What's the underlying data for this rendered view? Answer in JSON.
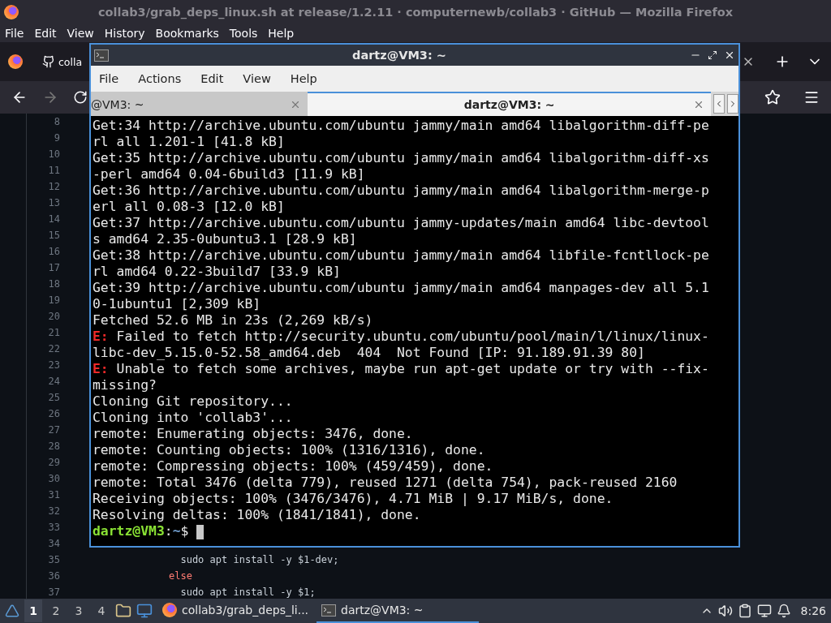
{
  "browser": {
    "title": "collab3/grab_deps_linux.sh at release/1.2.11 · computernewb/collab3 · GitHub — Mozilla Firefox",
    "menu": [
      "File",
      "Edit",
      "View",
      "History",
      "Bookmarks",
      "Tools",
      "Help"
    ],
    "tab": {
      "label": "colla"
    },
    "code": {
      "rows": [
        {
          "number": "8"
        },
        {
          "number": "9"
        },
        {
          "number": "10"
        },
        {
          "number": "11"
        },
        {
          "number": "12"
        },
        {
          "number": "13"
        },
        {
          "number": "14"
        },
        {
          "number": "15"
        },
        {
          "number": "16"
        },
        {
          "number": "17"
        },
        {
          "number": "18"
        },
        {
          "number": "19"
        },
        {
          "number": "20"
        },
        {
          "number": "21"
        },
        {
          "number": "22"
        },
        {
          "number": "23"
        },
        {
          "number": "24"
        },
        {
          "number": "25"
        },
        {
          "number": "26"
        },
        {
          "number": "27"
        },
        {
          "number": "28"
        },
        {
          "number": "29"
        },
        {
          "number": "30"
        },
        {
          "number": "31"
        },
        {
          "number": "32"
        },
        {
          "number": "33"
        },
        {
          "number": "34"
        },
        {
          "number": "35",
          "kind": "plain",
          "text": "  sudo apt install -y $1-dev;"
        },
        {
          "number": "36",
          "kind": "keyword",
          "text": "else"
        },
        {
          "number": "37",
          "kind": "plain",
          "text": "  sudo apt install -y $1;"
        }
      ]
    }
  },
  "terminal": {
    "title": "dartz@VM3: ~",
    "menu": [
      "File",
      "Actions",
      "Edit",
      "View",
      "Help"
    ],
    "tabs": [
      {
        "label": "@VM3: ~",
        "selected": false
      },
      {
        "label": "dartz@VM3: ~",
        "selected": true
      }
    ],
    "lines": [
      {
        "kind": "plain",
        "text": "Get:34 http://archive.ubuntu.com/ubuntu jammy/main amd64 libalgorithm-diff-pe"
      },
      {
        "kind": "plain",
        "text": "rl all 1.201-1 [41.8 kB]"
      },
      {
        "kind": "plain",
        "text": "Get:35 http://archive.ubuntu.com/ubuntu jammy/main amd64 libalgorithm-diff-xs"
      },
      {
        "kind": "plain",
        "text": "-perl amd64 0.04-6build3 [11.9 kB]"
      },
      {
        "kind": "plain",
        "text": "Get:36 http://archive.ubuntu.com/ubuntu jammy/main amd64 libalgorithm-merge-p"
      },
      {
        "kind": "plain",
        "text": "erl all 0.08-3 [12.0 kB]"
      },
      {
        "kind": "plain",
        "text": "Get:37 http://archive.ubuntu.com/ubuntu jammy-updates/main amd64 libc-devtool"
      },
      {
        "kind": "plain",
        "text": "s amd64 2.35-0ubuntu3.1 [28.9 kB]"
      },
      {
        "kind": "plain",
        "text": "Get:38 http://archive.ubuntu.com/ubuntu jammy/main amd64 libfile-fcntllock-pe"
      },
      {
        "kind": "plain",
        "text": "rl amd64 0.22-3build7 [33.9 kB]"
      },
      {
        "kind": "plain",
        "text": "Get:39 http://archive.ubuntu.com/ubuntu jammy/main amd64 manpages-dev all 5.1"
      },
      {
        "kind": "plain",
        "text": "0-1ubuntu1 [2,309 kB]"
      },
      {
        "kind": "plain",
        "text": "Fetched 52.6 MB in 23s (2,269 kB/s)"
      },
      {
        "kind": "error",
        "prefix": "E:",
        "text": " Failed to fetch http://security.ubuntu.com/ubuntu/pool/main/l/linux/linux-"
      },
      {
        "kind": "plain",
        "text": "libc-dev_5.15.0-52.58_amd64.deb  404  Not Found [IP: 91.189.91.39 80]"
      },
      {
        "kind": "error",
        "prefix": "E:",
        "text": " Unable to fetch some archives, maybe run apt-get update or try with --fix-"
      },
      {
        "kind": "plain",
        "text": "missing?"
      },
      {
        "kind": "plain",
        "text": "Cloning Git repository..."
      },
      {
        "kind": "plain",
        "text": "Cloning into 'collab3'..."
      },
      {
        "kind": "plain",
        "text": "remote: Enumerating objects: 3476, done."
      },
      {
        "kind": "plain",
        "text": "remote: Counting objects: 100% (1316/1316), done."
      },
      {
        "kind": "plain",
        "text": "remote: Compressing objects: 100% (459/459), done."
      },
      {
        "kind": "plain",
        "text": "remote: Total 3476 (delta 779), reused 1271 (delta 754), pack-reused 2160"
      },
      {
        "kind": "plain",
        "text": "Receiving objects: 100% (3476/3476), 4.71 MiB | 9.17 MiB/s, done."
      },
      {
        "kind": "plain",
        "text": "Resolving deltas: 100% (1841/1841), done."
      }
    ],
    "prompt": {
      "user": "dartz@VM3",
      "separator": ":",
      "path": "~",
      "symbol": "$"
    }
  },
  "taskbar": {
    "workspaces": [
      {
        "label": "1",
        "selected": true
      },
      {
        "label": "2",
        "selected": false
      },
      {
        "label": "3",
        "selected": false
      },
      {
        "label": "4",
        "selected": false
      }
    ],
    "tasks": [
      {
        "kind": "browser",
        "label": "collab3/grab_deps_li...",
        "selected": false
      },
      {
        "kind": "terminal",
        "label": "dartz@VM3: ~",
        "selected": true
      }
    ],
    "clock": "8:26"
  }
}
